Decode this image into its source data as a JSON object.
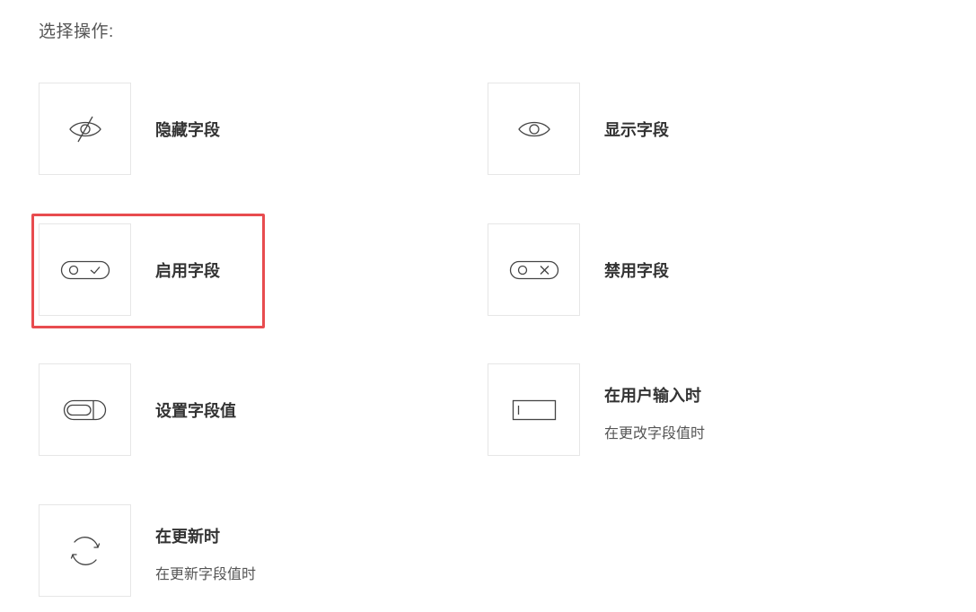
{
  "heading": "选择操作:",
  "options": {
    "hide": {
      "label": "隐藏字段",
      "icon": "eye-slash-icon"
    },
    "show": {
      "label": "显示字段",
      "icon": "eye-icon"
    },
    "enable": {
      "label": "启用字段",
      "icon": "toggle-check-icon"
    },
    "disable": {
      "label": "禁用字段",
      "icon": "toggle-x-icon"
    },
    "set_value": {
      "label": "设置字段值",
      "icon": "field-value-icon"
    },
    "on_input": {
      "label": "在用户输入时",
      "sublabel": "在更改字段值时",
      "icon": "text-cursor-field-icon"
    },
    "on_update": {
      "label": "在更新时",
      "sublabel": "在更新字段值时",
      "icon": "refresh-icon"
    }
  },
  "colors": {
    "highlight": "#e84c4f",
    "icon_stroke": "#444444",
    "box_border": "#e6e6e6"
  },
  "selected": "enable"
}
